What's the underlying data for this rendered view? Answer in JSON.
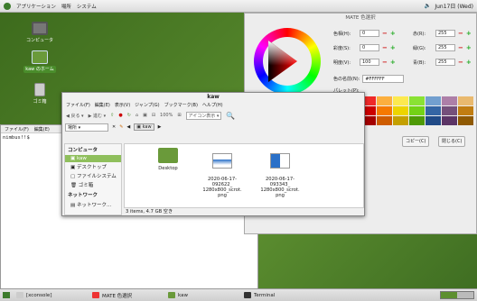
{
  "topbar": {
    "menu_apps": "アプリケーション",
    "menu_places": "場所",
    "menu_system": "システム",
    "clock": "Jun17日 (Wed)"
  },
  "desktop": {
    "icons": [
      {
        "label": "コンピュータ"
      },
      {
        "label": "kaw のホーム"
      },
      {
        "label": "ゴミ箱"
      }
    ]
  },
  "terminal": {
    "menu": [
      "ファイル(F)",
      "編集(E)"
    ],
    "prompt": "nimbus!!$"
  },
  "color_dialog": {
    "title": "MATE 色選択",
    "fields": {
      "hue": "色相(H):",
      "sat": "彩度(S):",
      "val": "明度(V):",
      "red": "赤(R):",
      "green": "緑(G):",
      "blue": "青(B):",
      "name": "色の名前(N):",
      "palette": "パレット(P):"
    },
    "values": {
      "hue": "0",
      "sat": "0",
      "val": "100",
      "red": "255",
      "green": "255",
      "blue": "255",
      "name": "#FFFFFF"
    },
    "copy_btn": "コピー(C)",
    "close_btn": "閉じる(C)"
  },
  "file_manager": {
    "title": "kaw",
    "menu": [
      "ファイル(F)",
      "編集(E)",
      "表示(V)",
      "ジャンプ(G)",
      "ブックマーク(B)",
      "ヘルプ(H)"
    ],
    "toolbar": {
      "back": "戻る",
      "forward": "進む",
      "zoom": "100%",
      "view": "アイコン表示"
    },
    "location": {
      "label": "場所",
      "crumb": "kaw"
    },
    "sidebar": {
      "h1": "コンピュータ",
      "items1": [
        "kaw",
        "デスクトップ",
        "ファイルシステム",
        "ゴミ箱"
      ],
      "h2": "ネットワーク",
      "items2": [
        "ネットワーク..."
      ]
    },
    "files": [
      {
        "name": "Desktop"
      },
      {
        "name": "2020-06-17-\n092622_\n1280x800_scrot.\npng"
      },
      {
        "name": "2020-06-17-\n093343_\n1280x800_scrot.\npng"
      }
    ],
    "status": "3 items, 4.7 GB 空き"
  },
  "taskbar": {
    "items": [
      "[xconsole]",
      "MATE 色選択",
      "kaw",
      "Terminal"
    ]
  },
  "colors": {
    "accent": "#4a8d2b",
    "desktop": "#4f7d2a"
  }
}
